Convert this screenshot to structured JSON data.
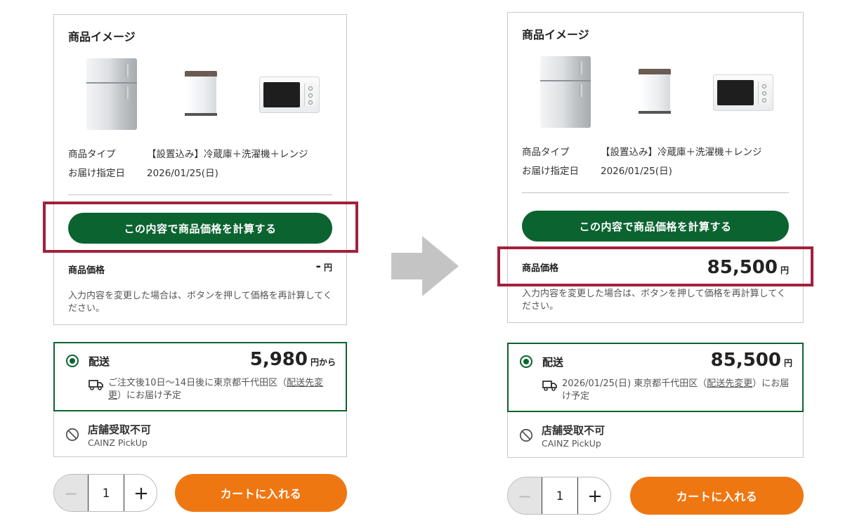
{
  "left": {
    "image_section_title": "商品イメージ",
    "spec_type_label": "商品タイプ",
    "spec_type_value": "【設置込み】冷蔵庫＋洗濯機＋レンジ",
    "spec_date_label": "お届け指定日",
    "spec_date_value": "2026/01/25(日)",
    "calc_button": "この内容で商品価格を計算する",
    "price_label": "商品価格",
    "price_value": "-",
    "price_unit": "円",
    "price_note": "入力内容を変更した場合は、ボタンを押して価格を再計算してください。",
    "shipping": {
      "title": "配送",
      "price": "5,980",
      "unit": "円から",
      "info_before_link": "ご注文後10日〜14日後に東京都千代田区（",
      "link": "配送先変更",
      "info_after_link": "）にお届け予定"
    },
    "pickup": {
      "title": "店舗受取不可",
      "subtitle": "CAINZ PickUp"
    },
    "quantity": {
      "minus": "−",
      "value": "1",
      "plus": "+"
    },
    "cart_button": "カートに入れる"
  },
  "right": {
    "image_section_title": "商品イメージ",
    "spec_type_label": "商品タイプ",
    "spec_type_value": "【設置込み】冷蔵庫＋洗濯機＋レンジ",
    "spec_date_label": "お届け指定日",
    "spec_date_value": "2026/01/25(日)",
    "calc_button": "この内容で商品価格を計算する",
    "price_label": "商品価格",
    "price_value": "85,500",
    "price_unit": "円",
    "price_note": "入力内容を変更した場合は、ボタンを押して価格を再計算してください。",
    "shipping": {
      "title": "配送",
      "price": "85,500",
      "unit": "円",
      "info_before_link": "2026/01/25(日) 東京都千代田区（",
      "link": "配送先変更",
      "info_after_link": "）にお届け予定"
    },
    "pickup": {
      "title": "店舗受取不可",
      "subtitle": "CAINZ PickUp"
    },
    "quantity": {
      "minus": "−",
      "value": "1",
      "plus": "+"
    },
    "cart_button": "カートに入れる"
  },
  "colors": {
    "brand_green": "#0b6330",
    "cart_orange": "#ef7712",
    "highlight_red": "#a3203c",
    "arrow_gray": "#c4c4c4"
  },
  "icons": [
    "fridge-image",
    "washer-image",
    "microwave-image",
    "truck-icon",
    "ban-icon",
    "radio-selected-icon",
    "right-arrow-icon"
  ]
}
